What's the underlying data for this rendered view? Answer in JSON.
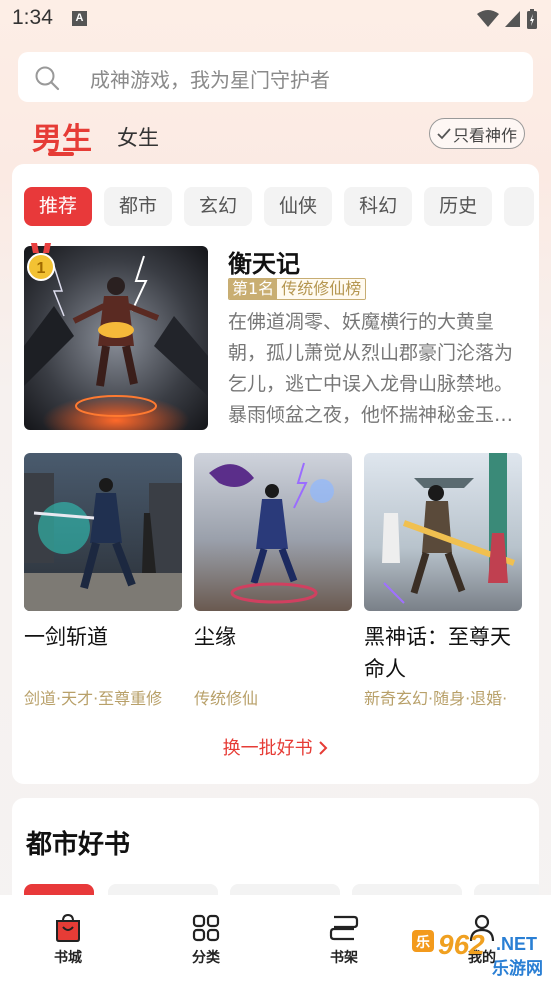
{
  "status": {
    "time": "1:34",
    "notif_icon": "A"
  },
  "search": {
    "placeholder": "成神游戏，我为星门守护者"
  },
  "gender_tabs": {
    "male": "男生",
    "female": "女生"
  },
  "filter": {
    "label": "只看神作"
  },
  "categories": [
    "推荐",
    "都市",
    "玄幻",
    "仙侠",
    "科幻",
    "历史"
  ],
  "featured": {
    "rank_icon": "1",
    "title": "衡天记",
    "rank_no": "第1名",
    "rank_list": "传统修仙榜",
    "description": "在佛道凋零、妖魔横行的大黄皇朝，孤儿萧觉从烈山郡豪门沦落为乞儿，逃亡中误入龙骨山脉禁地。暴雨倾盆之夜，他怀揣神秘金玉…"
  },
  "books": [
    {
      "title": "一剑斩道",
      "tags": "剑道·天才·至尊重修"
    },
    {
      "title": "尘缘",
      "tags": "传统修仙"
    },
    {
      "title": "黑神话：至尊天命人",
      "tags": "新奇玄幻·随身·退婚·"
    }
  ],
  "refresh": {
    "label": "换一批好书"
  },
  "section2": {
    "title": "都市好书"
  },
  "bottom_nav": [
    {
      "label": "书城",
      "icon": "bookstore-icon"
    },
    {
      "label": "分类",
      "icon": "grid-icon"
    },
    {
      "label": "书架",
      "icon": "bookshelf-icon"
    },
    {
      "label": "我的",
      "icon": "profile-icon"
    }
  ],
  "watermark": {
    "logo": "962",
    "net": ".NET",
    "site": "乐游网"
  },
  "colors": {
    "accent": "#e63c36",
    "gold": "#c9ae72",
    "tag": "#b8a069"
  }
}
